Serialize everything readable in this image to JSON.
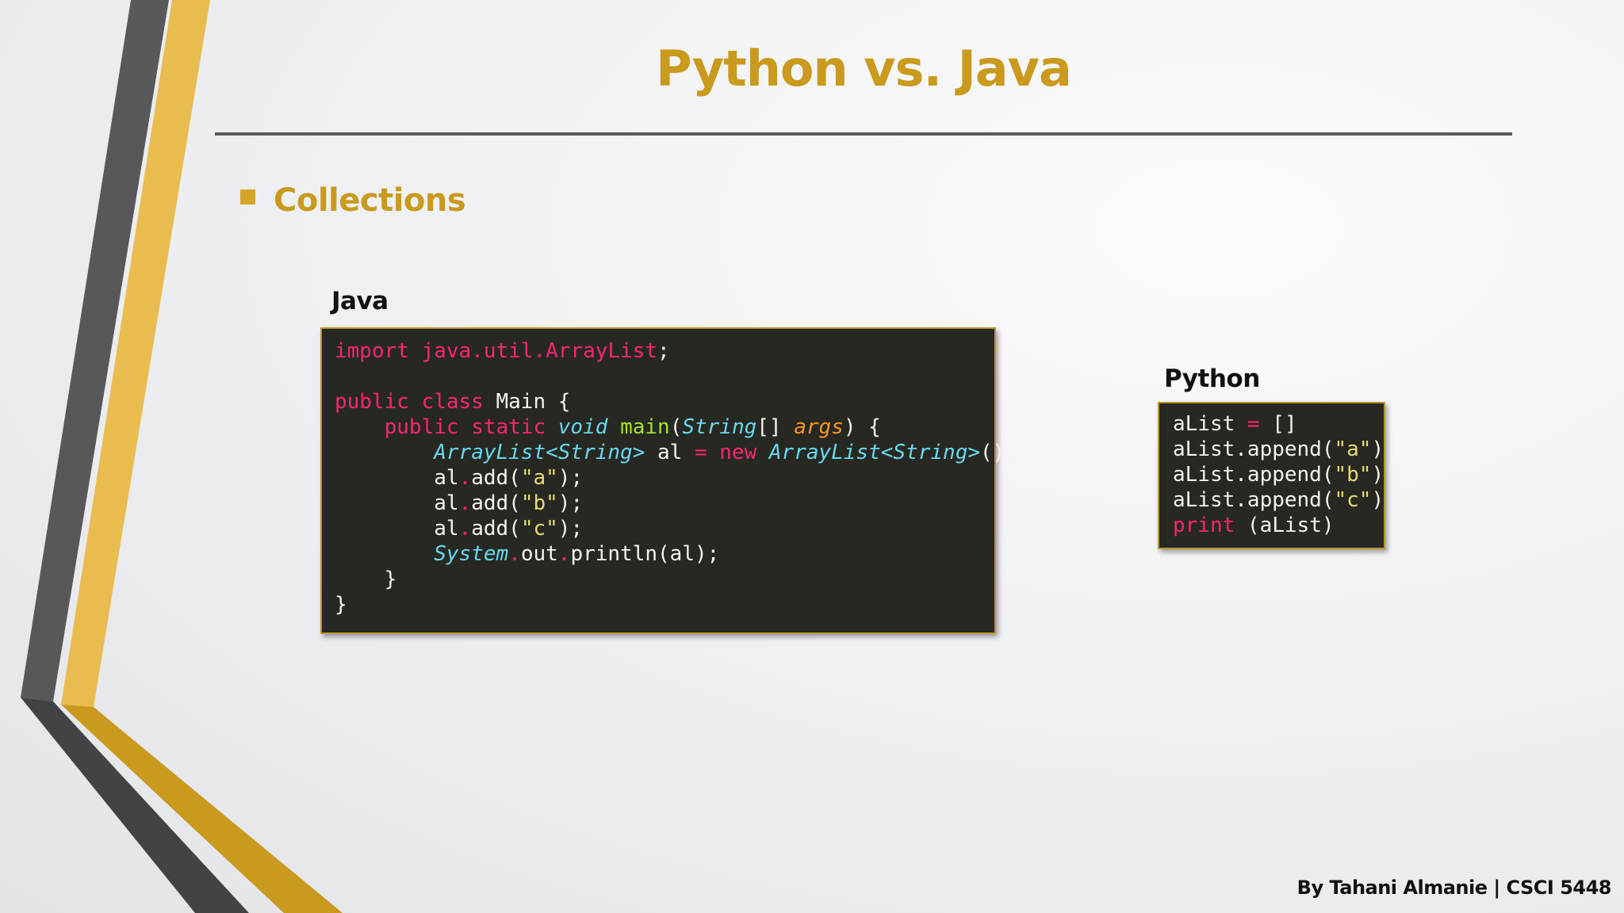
{
  "slide": {
    "title": "Python vs. Java",
    "bullet": "Collections",
    "footer": "By Tahani Almanie | CSCI 5448"
  },
  "java": {
    "label": "Java",
    "lines": [
      [
        {
          "t": "import java.util.ArrayList",
          "c": "kw"
        },
        {
          "t": ";",
          "c": ""
        }
      ],
      [],
      [
        {
          "t": "public class ",
          "c": "kw"
        },
        {
          "t": "Main {",
          "c": ""
        }
      ],
      [
        {
          "t": "    ",
          "c": ""
        },
        {
          "t": "public static ",
          "c": "kw"
        },
        {
          "t": "void ",
          "c": "ty"
        },
        {
          "t": "main",
          "c": "fn"
        },
        {
          "t": "(",
          "c": ""
        },
        {
          "t": "String",
          "c": "ty"
        },
        {
          "t": "[] ",
          "c": ""
        },
        {
          "t": "args",
          "c": "ar"
        },
        {
          "t": ") {",
          "c": ""
        }
      ],
      [
        {
          "t": "        ",
          "c": ""
        },
        {
          "t": "ArrayList<String>",
          "c": "ty"
        },
        {
          "t": " al ",
          "c": ""
        },
        {
          "t": "= new ",
          "c": "kw"
        },
        {
          "t": "ArrayList<String>",
          "c": "ty"
        },
        {
          "t": "();",
          "c": ""
        }
      ],
      [
        {
          "t": "        al",
          "c": ""
        },
        {
          "t": ".",
          "c": "kw"
        },
        {
          "t": "add(",
          "c": ""
        },
        {
          "t": "\"a\"",
          "c": "st"
        },
        {
          "t": ");",
          "c": ""
        }
      ],
      [
        {
          "t": "        al",
          "c": ""
        },
        {
          "t": ".",
          "c": "kw"
        },
        {
          "t": "add(",
          "c": ""
        },
        {
          "t": "\"b\"",
          "c": "st"
        },
        {
          "t": ");",
          "c": ""
        }
      ],
      [
        {
          "t": "        al",
          "c": ""
        },
        {
          "t": ".",
          "c": "kw"
        },
        {
          "t": "add(",
          "c": ""
        },
        {
          "t": "\"c\"",
          "c": "st"
        },
        {
          "t": ");",
          "c": ""
        }
      ],
      [
        {
          "t": "        ",
          "c": ""
        },
        {
          "t": "System",
          "c": "ty"
        },
        {
          "t": ".",
          "c": "kw"
        },
        {
          "t": "out",
          "c": ""
        },
        {
          "t": ".",
          "c": "kw"
        },
        {
          "t": "println(al);",
          "c": ""
        }
      ],
      [
        {
          "t": "    }",
          "c": ""
        }
      ],
      [
        {
          "t": "}",
          "c": ""
        }
      ]
    ]
  },
  "python": {
    "label": "Python",
    "lines": [
      [
        {
          "t": "aList ",
          "c": ""
        },
        {
          "t": "=",
          "c": "kw"
        },
        {
          "t": " []",
          "c": ""
        }
      ],
      [
        {
          "t": "aList.append(",
          "c": ""
        },
        {
          "t": "\"a\"",
          "c": "st"
        },
        {
          "t": ")",
          "c": ""
        }
      ],
      [
        {
          "t": "aList.append(",
          "c": ""
        },
        {
          "t": "\"b\"",
          "c": "st"
        },
        {
          "t": ")",
          "c": ""
        }
      ],
      [
        {
          "t": "aList.append(",
          "c": ""
        },
        {
          "t": "\"c\"",
          "c": "st"
        },
        {
          "t": ")",
          "c": ""
        }
      ],
      [
        {
          "t": "print",
          "c": "kw"
        },
        {
          "t": " (aList)",
          "c": ""
        }
      ]
    ]
  },
  "colors": {
    "accent": "#c99a1e",
    "code_bg": "#272822",
    "code_border": "#b8962c",
    "keyword": "#f92672",
    "type": "#66d9ef",
    "function": "#a6e22e",
    "argument": "#fd971f",
    "string": "#e6db74"
  }
}
